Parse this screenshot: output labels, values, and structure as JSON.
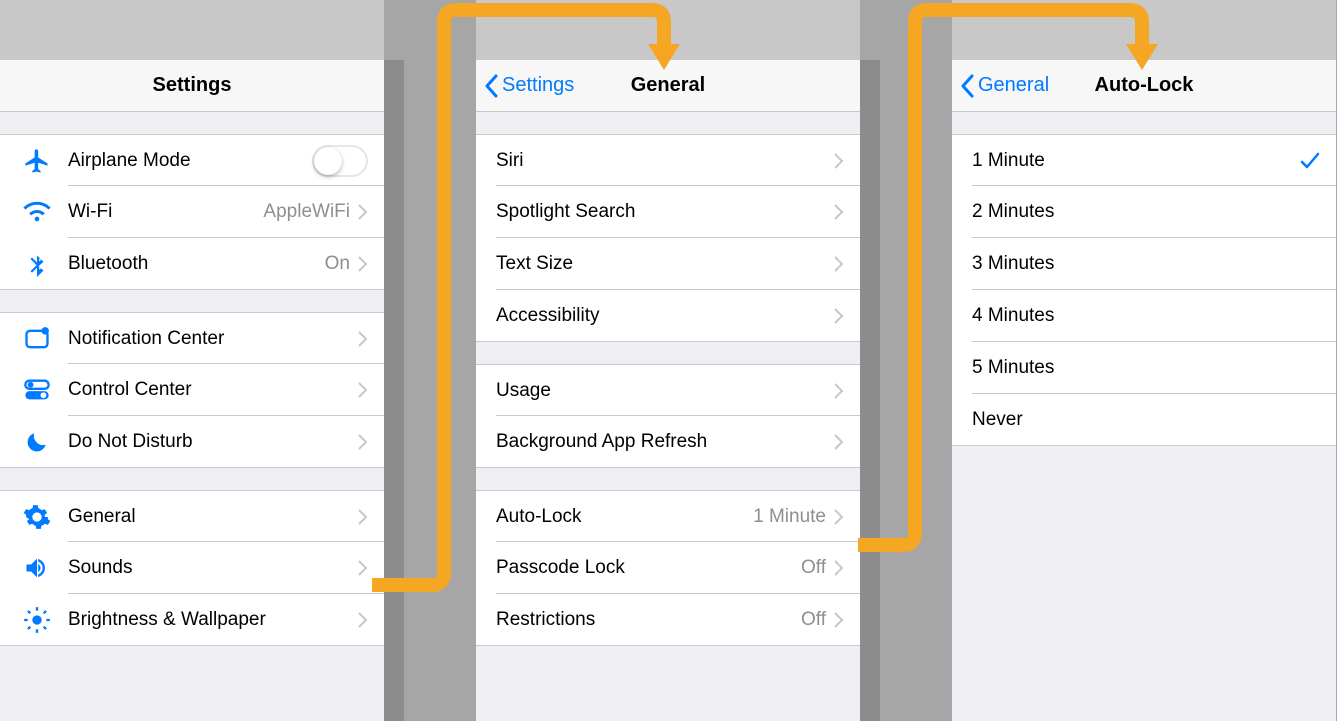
{
  "settings": {
    "title": "Settings",
    "groups": [
      [
        {
          "icon": "airplane",
          "label": "Airplane Mode",
          "control": "toggle"
        },
        {
          "icon": "wifi",
          "label": "Wi-Fi",
          "value": "AppleWiFi",
          "control": "chevron"
        },
        {
          "icon": "bluetooth",
          "label": "Bluetooth",
          "value": "On",
          "control": "chevron"
        }
      ],
      [
        {
          "icon": "notification",
          "label": "Notification Center",
          "control": "chevron"
        },
        {
          "icon": "controlcenter",
          "label": "Control Center",
          "control": "chevron"
        },
        {
          "icon": "dnd",
          "label": "Do Not Disturb",
          "control": "chevron"
        }
      ],
      [
        {
          "icon": "general",
          "label": "General",
          "control": "chevron"
        },
        {
          "icon": "sounds",
          "label": "Sounds",
          "control": "chevron"
        },
        {
          "icon": "brightness",
          "label": "Brightness & Wallpaper",
          "control": "chevron"
        }
      ]
    ]
  },
  "general": {
    "back": "Settings",
    "title": "General",
    "groups": [
      [
        {
          "label": "Siri",
          "control": "chevron"
        },
        {
          "label": "Spotlight Search",
          "control": "chevron"
        },
        {
          "label": "Text Size",
          "control": "chevron"
        },
        {
          "label": "Accessibility",
          "control": "chevron"
        }
      ],
      [
        {
          "label": "Usage",
          "control": "chevron"
        },
        {
          "label": "Background App Refresh",
          "control": "chevron"
        }
      ],
      [
        {
          "label": "Auto-Lock",
          "value": "1 Minute",
          "control": "chevron"
        },
        {
          "label": "Passcode Lock",
          "value": "Off",
          "control": "chevron"
        },
        {
          "label": "Restrictions",
          "value": "Off",
          "control": "chevron"
        }
      ]
    ]
  },
  "autolock": {
    "back": "General",
    "title": "Auto-Lock",
    "options": [
      {
        "label": "1 Minute",
        "selected": true
      },
      {
        "label": "2 Minutes"
      },
      {
        "label": "3 Minutes"
      },
      {
        "label": "4 Minutes"
      },
      {
        "label": "5 Minutes"
      },
      {
        "label": "Never"
      }
    ]
  }
}
